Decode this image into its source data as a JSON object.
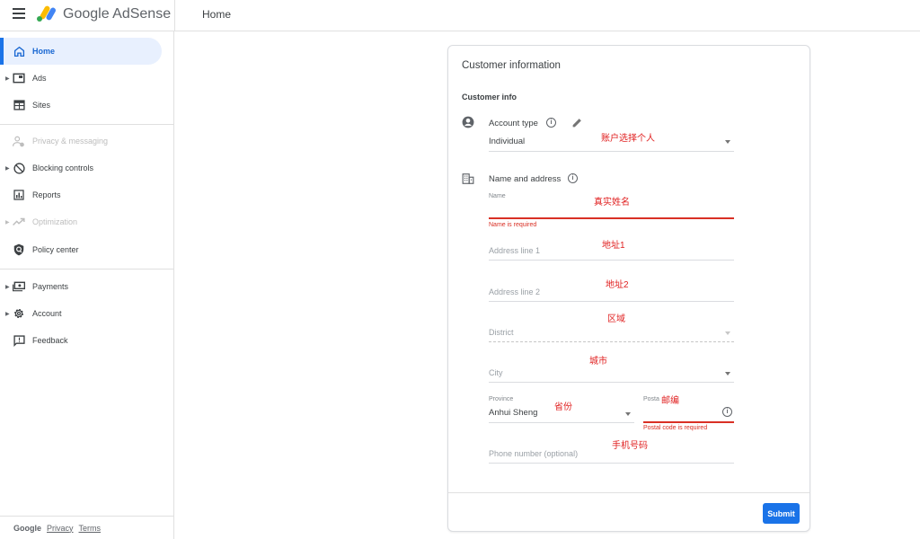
{
  "header": {
    "app_name": "Google AdSense",
    "page_title": "Home"
  },
  "sidebar": {
    "items": [
      {
        "label": "Home",
        "icon": "home-icon",
        "active": true,
        "expandable": false,
        "disabled": false
      },
      {
        "label": "Ads",
        "icon": "ads-icon",
        "active": false,
        "expandable": true,
        "disabled": false
      },
      {
        "label": "Sites",
        "icon": "sites-icon",
        "active": false,
        "expandable": false,
        "disabled": false
      },
      {
        "label": "Privacy & messaging",
        "icon": "privacy-icon",
        "active": false,
        "expandable": false,
        "disabled": true
      },
      {
        "label": "Blocking controls",
        "icon": "block-icon",
        "active": false,
        "expandable": true,
        "disabled": false
      },
      {
        "label": "Reports",
        "icon": "reports-icon",
        "active": false,
        "expandable": false,
        "disabled": false
      },
      {
        "label": "Optimization",
        "icon": "trending-icon",
        "active": false,
        "expandable": true,
        "disabled": true
      },
      {
        "label": "Policy center",
        "icon": "policy-shield-icon",
        "active": false,
        "expandable": false,
        "disabled": false
      },
      {
        "label": "Payments",
        "icon": "payments-icon",
        "active": false,
        "expandable": true,
        "disabled": false
      },
      {
        "label": "Account",
        "icon": "gear-icon",
        "active": false,
        "expandable": true,
        "disabled": false
      },
      {
        "label": "Feedback",
        "icon": "feedback-icon",
        "active": false,
        "expandable": false,
        "disabled": false
      }
    ],
    "footer": {
      "brand": "Google",
      "privacy": "Privacy",
      "terms": "Terms"
    }
  },
  "form": {
    "title": "Customer information",
    "section": "Customer info",
    "account_type": {
      "label": "Account type",
      "value": "Individual",
      "annotation": "账户选择个人"
    },
    "name_address": {
      "label": "Name and address",
      "name": {
        "label": "Name",
        "value": "",
        "error": "Name is required",
        "annotation": "真实姓名"
      },
      "address1": {
        "placeholder": "Address line 1",
        "annotation": "地址1"
      },
      "address2": {
        "placeholder": "Address line 2",
        "annotation": "地址2"
      },
      "district": {
        "placeholder": "District",
        "annotation": "区域"
      },
      "city": {
        "placeholder": "City",
        "annotation": "城市"
      },
      "province": {
        "label": "Province",
        "value": "Anhui Sheng",
        "annotation": "省份"
      },
      "postal": {
        "label": "Posta",
        "value": "",
        "error": "Postal code is required",
        "annotation": "邮编"
      },
      "phone": {
        "placeholder": "Phone number (optional)",
        "annotation": "手机号码"
      }
    },
    "submit_label": "Submit"
  },
  "colors": {
    "accent": "#1a73e8",
    "error": "#d93025",
    "annotation": "#e02020"
  }
}
